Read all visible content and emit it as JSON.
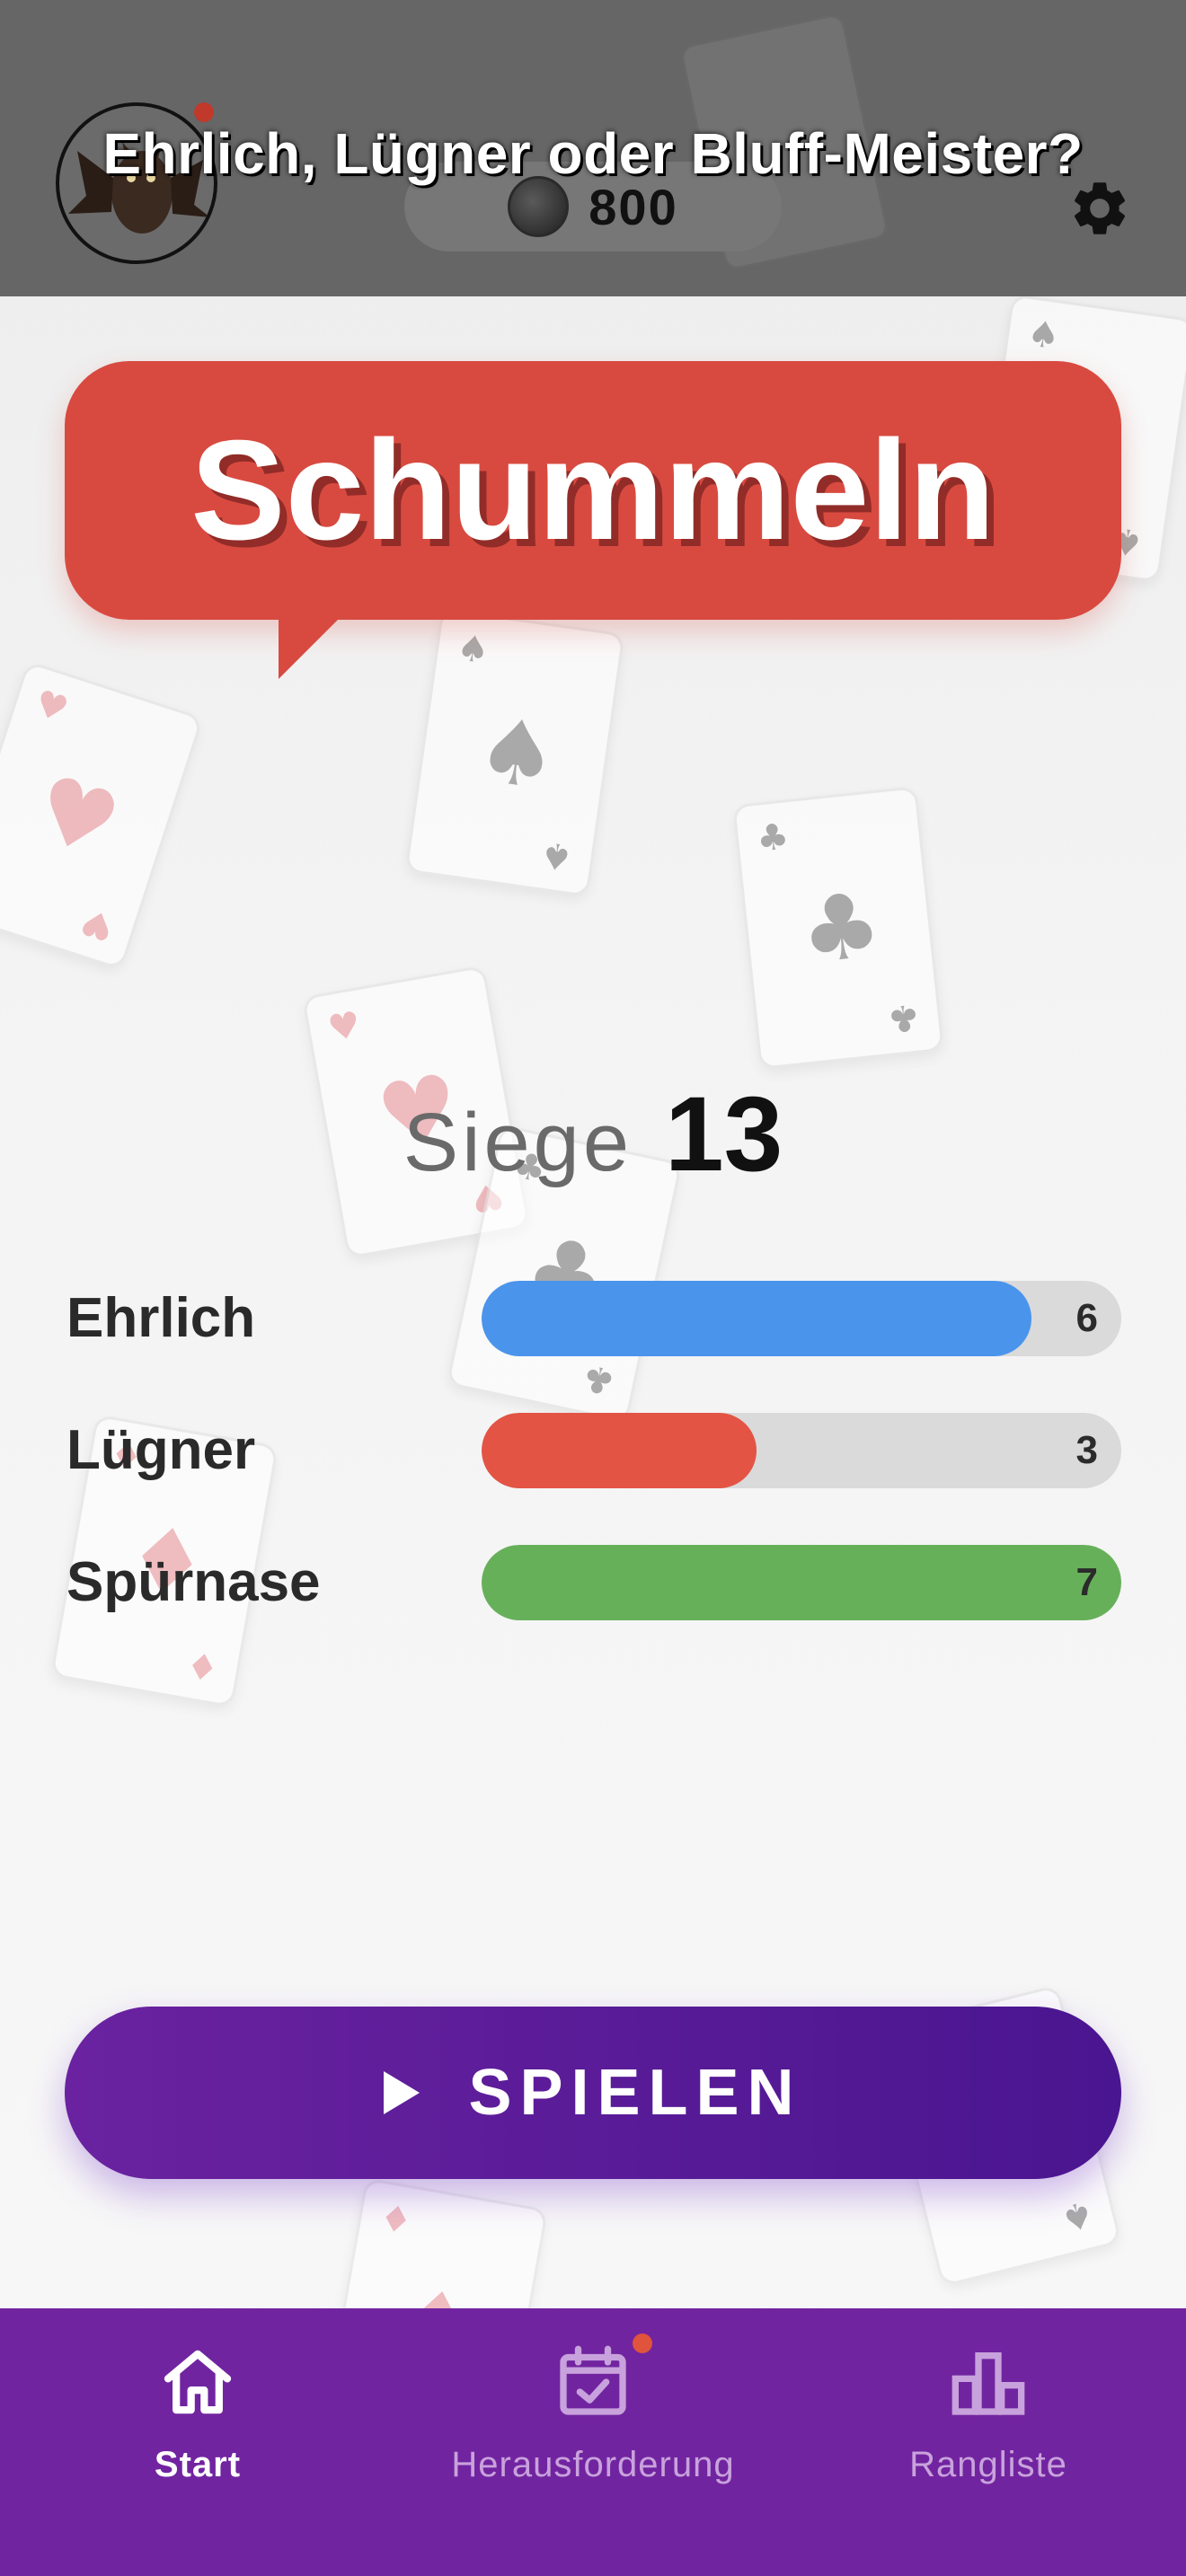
{
  "header": {
    "title": "Ehrlich, Lügner oder Bluff-Meister?",
    "coins": "800",
    "avatar_icon": "bat-avatar-icon",
    "settings_icon": "gear-icon"
  },
  "game": {
    "mode": "Schummeln"
  },
  "stats": {
    "wins_label": "Siege",
    "wins_value": "13",
    "rows": [
      {
        "label": "Ehrlich",
        "value": 6,
        "value_text": "6",
        "fill_fraction": 0.86,
        "color": "#4a94ec"
      },
      {
        "label": "Lügner",
        "value": 3,
        "value_text": "3",
        "fill_fraction": 0.43,
        "color": "#e35444"
      },
      {
        "label": "Spürnase",
        "value": 7,
        "value_text": "7",
        "fill_fraction": 1.0,
        "color": "#67b05a"
      }
    ]
  },
  "play_button": {
    "label": "SPIELEN",
    "icon": "play-icon"
  },
  "nav": {
    "tabs": [
      {
        "label": "Start",
        "icon": "home-icon",
        "active": true
      },
      {
        "label": "Herausforderung",
        "icon": "calendar-check-icon",
        "active": false,
        "badge": true
      },
      {
        "label": "Rangliste",
        "icon": "leaderboard-icon",
        "active": false
      }
    ]
  },
  "colors": {
    "accent_purple": "#7124a0",
    "bubble_red": "#d84a40",
    "header_gray": "#666666"
  }
}
